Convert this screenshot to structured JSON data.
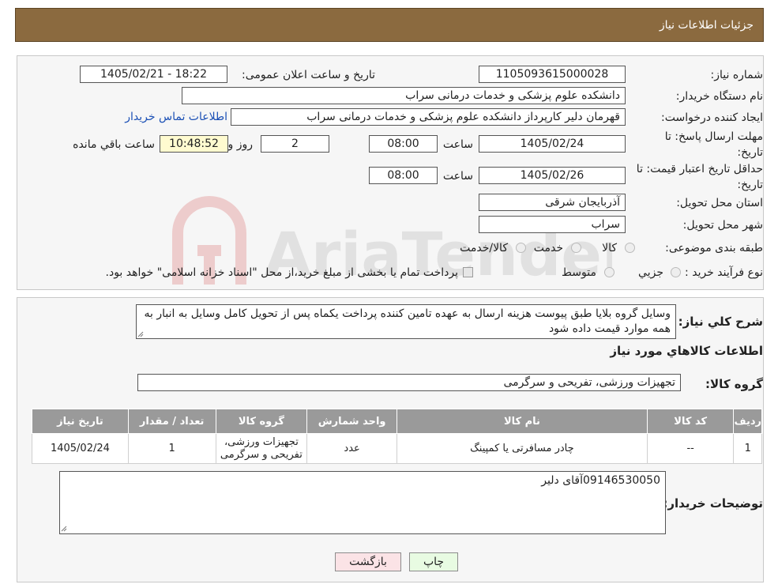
{
  "header": {
    "title": "جزئیات اطلاعات نیاز"
  },
  "form": {
    "need_number_label": "شماره نیاز:",
    "need_number": "1105093615000028",
    "announce_label": "تاریخ و ساعت اعلان عمومی:",
    "announce_value": "1405/02/21 - 18:22",
    "buyer_org_label": "نام دستگاه خریدار:",
    "buyer_org": "دانشکده علوم پزشکی و خدمات درمانی سراب",
    "creator_label": "ایجاد کننده درخواست:",
    "creator": "قهرمان دلیر کارپرداز دانشکده علوم پزشکی و خدمات درمانی سراب",
    "contact_link": "اطلاعات تماس خریدار",
    "deadline_label_1": "مهلت ارسال پاسخ: تا",
    "deadline_label_2": "تاریخ:",
    "deadline_date": "1405/02/24",
    "time_label": "ساعت",
    "deadline_time": "08:00",
    "days_value": "2",
    "days_label": "روز و",
    "remaining_time": "10:48:52",
    "remaining_label": "ساعت باقي مانده",
    "validity_label_1": "حداقل تاريخ اعتبار قيمت: تا",
    "validity_label_2": "تاریخ:",
    "validity_date": "1405/02/26",
    "validity_time": "08:00",
    "province_label": "استان محل تحویل:",
    "province": "آذربایجان شرقی",
    "city_label": "شهر محل تحویل:",
    "city": "سراب",
    "category_label": "طبقه بندی موضوعی:",
    "category_options": [
      "کالا",
      "خدمت",
      "کالا/خدمت"
    ],
    "process_label": "نوع فرآیند خرید :",
    "process_options": [
      "جزیي",
      "متوسط"
    ],
    "process_note": "پرداخت تمام یا بخشی از مبلغ خرید،از محل \"اسناد خزانه اسلامی\" خواهد بود."
  },
  "description": {
    "label": "شرح کلي نياز:",
    "text": "وسایل گروه بلایا طبق پیوست هزینه ارسال به عهده تامین کننده پرداخت یکماه پس از تحویل کامل وسایل به انبار به همه موارد قیمت داده شود"
  },
  "goods": {
    "section_title": "اطلاعات کالاهاي مورد نياز",
    "group_label": "گروه کالا:",
    "group_value": "تجهیزات ورزشی، تفریحی و سرگرمی",
    "columns": [
      "رديف",
      "کد کالا",
      "نام کالا",
      "واحد شمارش",
      "گروه کالا",
      "تعداد / مقدار",
      "تاریخ نیاز"
    ],
    "rows": [
      {
        "row": "1",
        "code": "--",
        "name": "چادر مسافرتی یا کمپینگ",
        "unit": "عدد",
        "group_1": "تجهیزات ورزشی،",
        "group_2": "تفریحی و سرگرمی",
        "qty": "1",
        "date": "1405/02/24"
      }
    ]
  },
  "notes": {
    "label": "توضيحات خريدار:",
    "text": "09146530050آقای دلیر"
  },
  "buttons": {
    "print": "چاپ",
    "back": "بازگشت"
  },
  "watermark": {
    "text": "AriaTender.neT"
  }
}
